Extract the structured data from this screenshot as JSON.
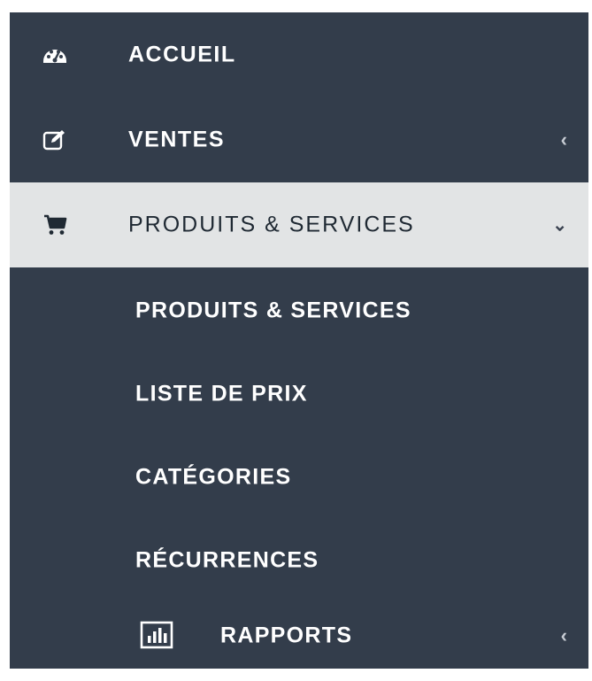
{
  "sidebar": {
    "items": [
      {
        "label": "ACCUEIL",
        "icon": "dashboard-icon"
      },
      {
        "label": "VENTES",
        "icon": "edit-icon",
        "chevron": "‹"
      },
      {
        "label": "PRODUITS & SERVICES",
        "icon": "cart-icon",
        "chevron": "⌄",
        "active": true
      }
    ],
    "subitems": [
      {
        "label": "PRODUITS & SERVICES"
      },
      {
        "label": "LISTE DE PRIX"
      },
      {
        "label": "CATÉGORIES"
      },
      {
        "label": "RÉCURRENCES"
      },
      {
        "label": "RAPPORTS",
        "icon": "bar-chart-icon",
        "chevron": "‹"
      }
    ]
  },
  "colors": {
    "sidebar_bg": "#333d4b",
    "active_bg": "#e2e4e5",
    "text": "#ffffff",
    "active_text": "#1f2933"
  }
}
